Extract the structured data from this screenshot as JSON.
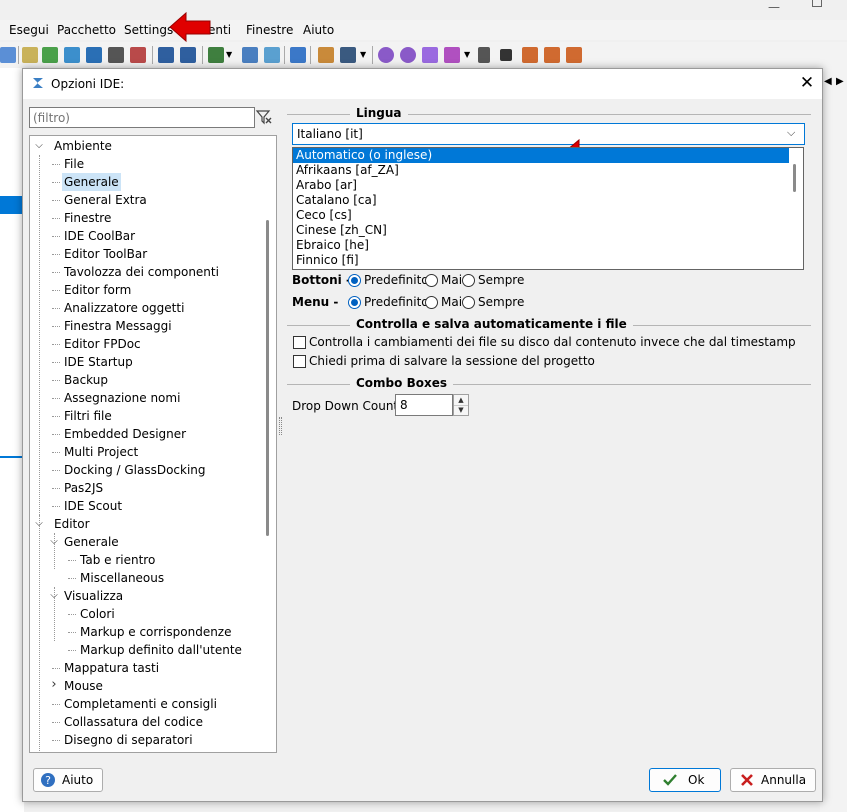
{
  "menubar": {
    "items": [
      "Esegui",
      "Pacchetto",
      "Settings",
      "enti",
      "Finestre",
      "Aiuto"
    ]
  },
  "colors": {
    "accent": "#0078d7",
    "selection": "#cce4f7",
    "annotation": "#e00000"
  },
  "dialog": {
    "title": "Opzioni IDE:",
    "filter_placeholder": "(filtro)",
    "tree": [
      {
        "label": "Ambiente",
        "level": 0,
        "expander": "down"
      },
      {
        "label": "File",
        "level": 1
      },
      {
        "label": "Generale",
        "level": 1,
        "selected": true
      },
      {
        "label": "General Extra",
        "level": 1
      },
      {
        "label": "Finestre",
        "level": 1
      },
      {
        "label": "IDE CoolBar",
        "level": 1
      },
      {
        "label": "Editor ToolBar",
        "level": 1
      },
      {
        "label": "Tavolozza dei componenti",
        "level": 1
      },
      {
        "label": "Editor form",
        "level": 1
      },
      {
        "label": "Analizzatore oggetti",
        "level": 1
      },
      {
        "label": "Finestra Messaggi",
        "level": 1
      },
      {
        "label": "Editor FPDoc",
        "level": 1
      },
      {
        "label": "IDE Startup",
        "level": 1
      },
      {
        "label": "Backup",
        "level": 1
      },
      {
        "label": "Assegnazione nomi",
        "level": 1
      },
      {
        "label": "Filtri file",
        "level": 1
      },
      {
        "label": "Embedded Designer",
        "level": 1
      },
      {
        "label": "Multi Project",
        "level": 1
      },
      {
        "label": "Docking / GlassDocking",
        "level": 1
      },
      {
        "label": "Pas2JS",
        "level": 1
      },
      {
        "label": "IDE Scout",
        "level": 1
      },
      {
        "label": "Editor",
        "level": 0,
        "expander": "down"
      },
      {
        "label": "Generale",
        "level": 1,
        "expander": "down"
      },
      {
        "label": "Tab e rientro",
        "level": 2
      },
      {
        "label": "Miscellaneous",
        "level": 2
      },
      {
        "label": "Visualizza",
        "level": 1,
        "expander": "down"
      },
      {
        "label": "Colori",
        "level": 2
      },
      {
        "label": "Markup e corrispondenze",
        "level": 2
      },
      {
        "label": "Markup definito dall'utente",
        "level": 2
      },
      {
        "label": "Mappatura tasti",
        "level": 1
      },
      {
        "label": "Mouse",
        "level": 1,
        "expander": "right"
      },
      {
        "label": "Completamenti e consigli",
        "level": 1
      },
      {
        "label": "Collassatura del codice",
        "level": 1
      },
      {
        "label": "Disegno di separatori",
        "level": 1
      }
    ],
    "language": {
      "section_title": "Lingua",
      "selected": "Italiano [it]",
      "options": [
        "Automatico (o inglese)",
        "Afrikaans [af_ZA]",
        "Arabo [ar]",
        "Catalano [ca]",
        "Ceco [cs]",
        "Cinese [zh_CN]",
        "Ebraico [he]",
        "Finnico [fi]"
      ],
      "highlighted_index": 0
    },
    "buttons_row": {
      "label": "Bottoni -",
      "options": [
        "Predefinito",
        "Mai",
        "Sempre"
      ],
      "selected": 0
    },
    "menu_row": {
      "label": "Menu -",
      "options": [
        "Predefinito",
        "Mai",
        "Sempre"
      ],
      "selected": 0
    },
    "autosave": {
      "section_title": "Controlla e salva automaticamente i file",
      "check_disk": "Controlla i cambiamenti dei file su disco dal contenuto invece che dal timestamp",
      "ask_save": "Chiedi prima di salvare la sessione del progetto"
    },
    "combo": {
      "section_title": "Combo Boxes",
      "dropdown_label": "Drop Down Count",
      "dropdown_value": "8"
    },
    "help_label": "Aiuto",
    "ok_label": "Ok",
    "cancel_label": "Annulla"
  }
}
